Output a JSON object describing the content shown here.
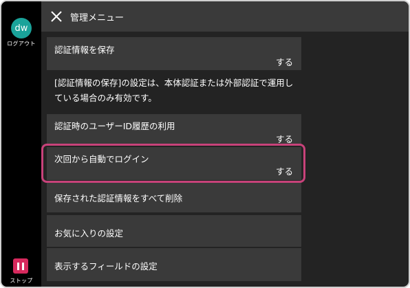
{
  "rail": {
    "avatar_text": "dw",
    "logout_label": "ログアウト",
    "stop_label": "ストップ"
  },
  "header": {
    "title": "管理メニュー",
    "close_icon": "close-icon"
  },
  "items": [
    {
      "title": "認証情報を保存",
      "value": "する"
    },
    {
      "title": "認証時のユーザーID履歴の利用",
      "value": "する"
    },
    {
      "title": "次回から自動でログイン",
      "value": "する"
    },
    {
      "title": "保存された認証情報をすべて削除"
    },
    {
      "title": "お気に入りの設定"
    },
    {
      "title": "表示するフィールドの設定"
    }
  ],
  "note": {
    "text": "[認証情報の保存]の設定は、本体認証または外部認証で運用している場合のみ有効です。"
  },
  "colors": {
    "avatar": "#1aa39a",
    "stop": "#d7295d",
    "highlight": "#c8427a",
    "panel": "#3a3a3a",
    "background": "#232323"
  }
}
